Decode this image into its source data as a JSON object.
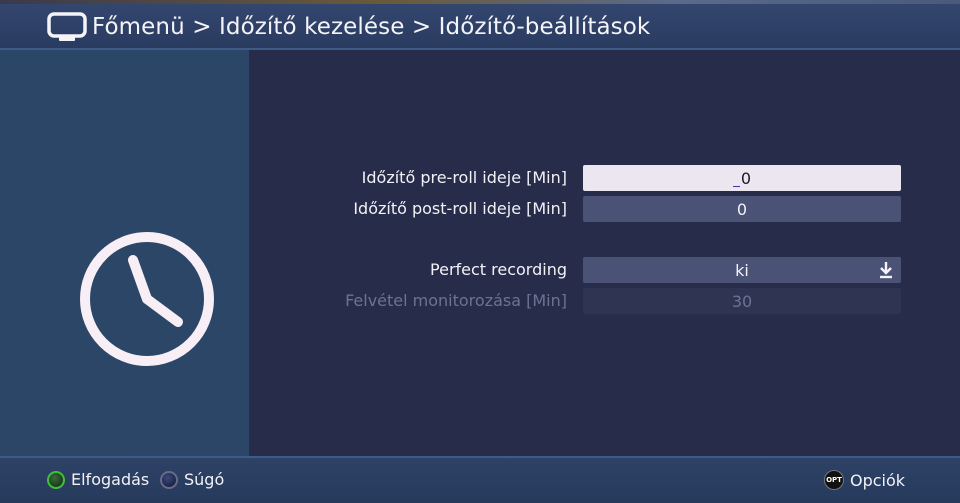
{
  "header": {
    "breadcrumb": "Főmenü > Időzítő kezelése > Időzítő-beállítások"
  },
  "settings": [
    {
      "label": "Időzítő pre-roll ideje [Min]",
      "value": "0",
      "state": "active"
    },
    {
      "label": "Időzítő post-roll ideje [Min]",
      "value": "0",
      "state": "normal"
    },
    {
      "label": "Perfect recording",
      "value": "ki",
      "state": "dropdown"
    },
    {
      "label": "Felvétel monitorozása [Min]",
      "value": "30",
      "state": "disabled"
    }
  ],
  "footer": {
    "accept_label": "Elfogadás",
    "help_label": "Súgó",
    "opt_badge": "OPT",
    "options_label": "Opciók"
  },
  "icons": {
    "header": "tv-icon",
    "panel": "clock-icon",
    "dropdown": "arrow-down-icon"
  },
  "colors": {
    "accent_green": "#3fbf3f",
    "active_field": "#ebe6ef",
    "panel": "#2c4668"
  }
}
